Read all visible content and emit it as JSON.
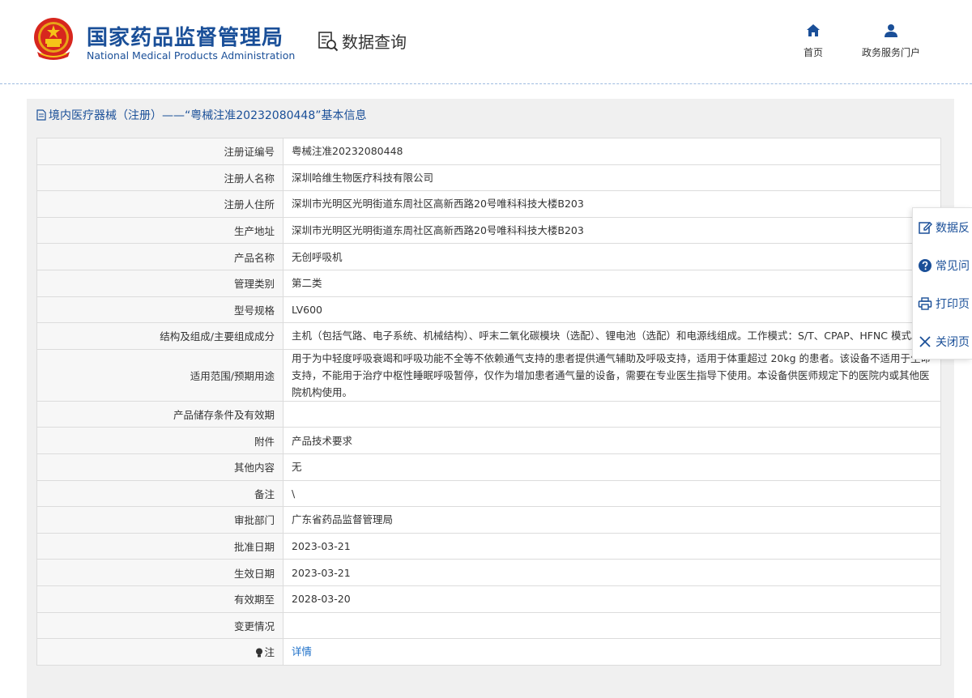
{
  "header": {
    "brand_cn": "国家药品监督管理局",
    "brand_en": "National Medical Products Administration",
    "query_label": "数据查询",
    "nav": {
      "home": "首页",
      "portal": "政务服务门户"
    }
  },
  "panel": {
    "title": "境内医疗器械（注册）——“粤械注准20232080448”基本信息"
  },
  "rows": [
    {
      "key": "注册证编号",
      "value": "粤械注准20232080448"
    },
    {
      "key": "注册人名称",
      "value": "深圳哈维生物医疗科技有限公司"
    },
    {
      "key": "注册人住所",
      "value": "深圳市光明区光明街道东周社区高新西路20号唯科科技大楼B203"
    },
    {
      "key": "生产地址",
      "value": "深圳市光明区光明街道东周社区高新西路20号唯科科技大楼B203"
    },
    {
      "key": "产品名称",
      "value": "无创呼吸机"
    },
    {
      "key": "管理类别",
      "value": "第二类"
    },
    {
      "key": "型号规格",
      "value": "LV600"
    },
    {
      "key": "结构及组成/主要组成成分",
      "value": "主机（包括气路、电子系统、机械结构）、呼末二氧化碳模块（选配）、锂电池（选配）和电源线组成。工作模式：S/T、CPAP、HFNC 模式。"
    },
    {
      "key": "适用范围/预期用途",
      "value": "用于为中轻度呼吸衰竭和呼吸功能不全等不依赖通气支持的患者提供通气辅助及呼吸支持，适用于体重超过 20kg 的患者。该设备不适用于生命支持，不能用于治疗中枢性睡眠呼吸暂停，仅作为增加患者通气量的设备，需要在专业医生指导下使用。本设备供医师规定下的医院内或其他医院机构使用。"
    },
    {
      "key": "产品储存条件及有效期",
      "value": ""
    },
    {
      "key": "附件",
      "value": "产品技术要求"
    },
    {
      "key": "其他内容",
      "value": "无"
    },
    {
      "key": "备注",
      "value": "\\"
    },
    {
      "key": "审批部门",
      "value": "广东省药品监督管理局"
    },
    {
      "key": "批准日期",
      "value": "2023-03-21"
    },
    {
      "key": "生效日期",
      "value": "2023-03-21"
    },
    {
      "key": "有效期至",
      "value": "2028-03-20"
    },
    {
      "key": "变更情况",
      "value": ""
    }
  ],
  "note_row": {
    "key": "注",
    "link": "详情"
  },
  "float_menu": {
    "feedback": "数据反",
    "faq": "常见问",
    "print": "打印页",
    "close": "关闭页"
  },
  "colors": {
    "brand_blue": "#1a4f98",
    "link_blue": "#1a6ec8",
    "panel_bg": "#f0f0f0"
  }
}
